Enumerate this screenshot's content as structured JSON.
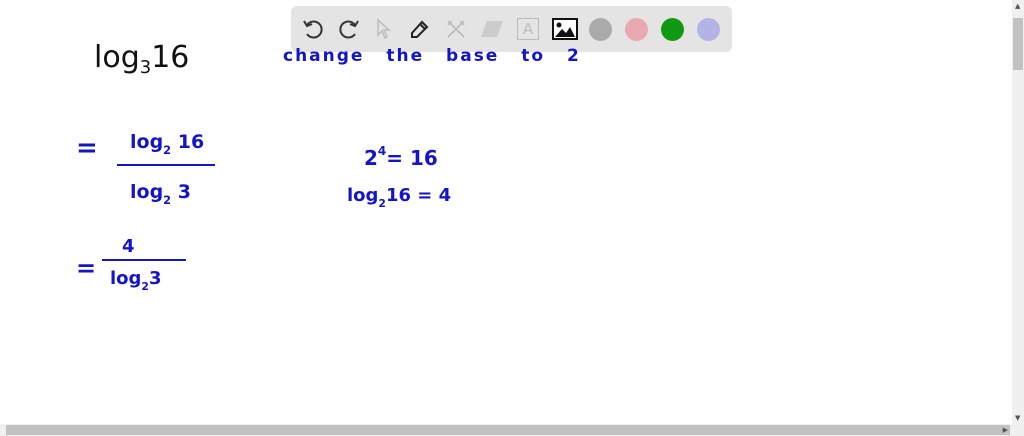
{
  "toolbar": {
    "tools": [
      "undo-icon",
      "redo-icon",
      "pointer-icon",
      "pen-icon",
      "tools-icon",
      "eraser-icon",
      "text-icon",
      "image-icon"
    ],
    "text_tool_label": "A",
    "colors": [
      "#aaaaaa",
      "#e8a9b2",
      "#119911",
      "#b3b3e6"
    ]
  },
  "board": {
    "problem": {
      "base_text": "log",
      "base": "3",
      "arg": "16"
    },
    "instruction": "change the base to 2",
    "step1": {
      "eq": "=",
      "num_log": "log",
      "num_base": "2",
      "num_arg": "16",
      "den_log": "log",
      "den_base": "2",
      "den_arg": "3"
    },
    "side1": {
      "base": "2",
      "exp": "4",
      "rest": "= 16"
    },
    "side2": {
      "log": "log",
      "base": "2",
      "rest": "16 = 4"
    },
    "step2": {
      "eq": "=",
      "num": "4",
      "den_log": "log",
      "den_base": "2",
      "den_arg": "3"
    }
  },
  "ink_color": "#1515c8"
}
